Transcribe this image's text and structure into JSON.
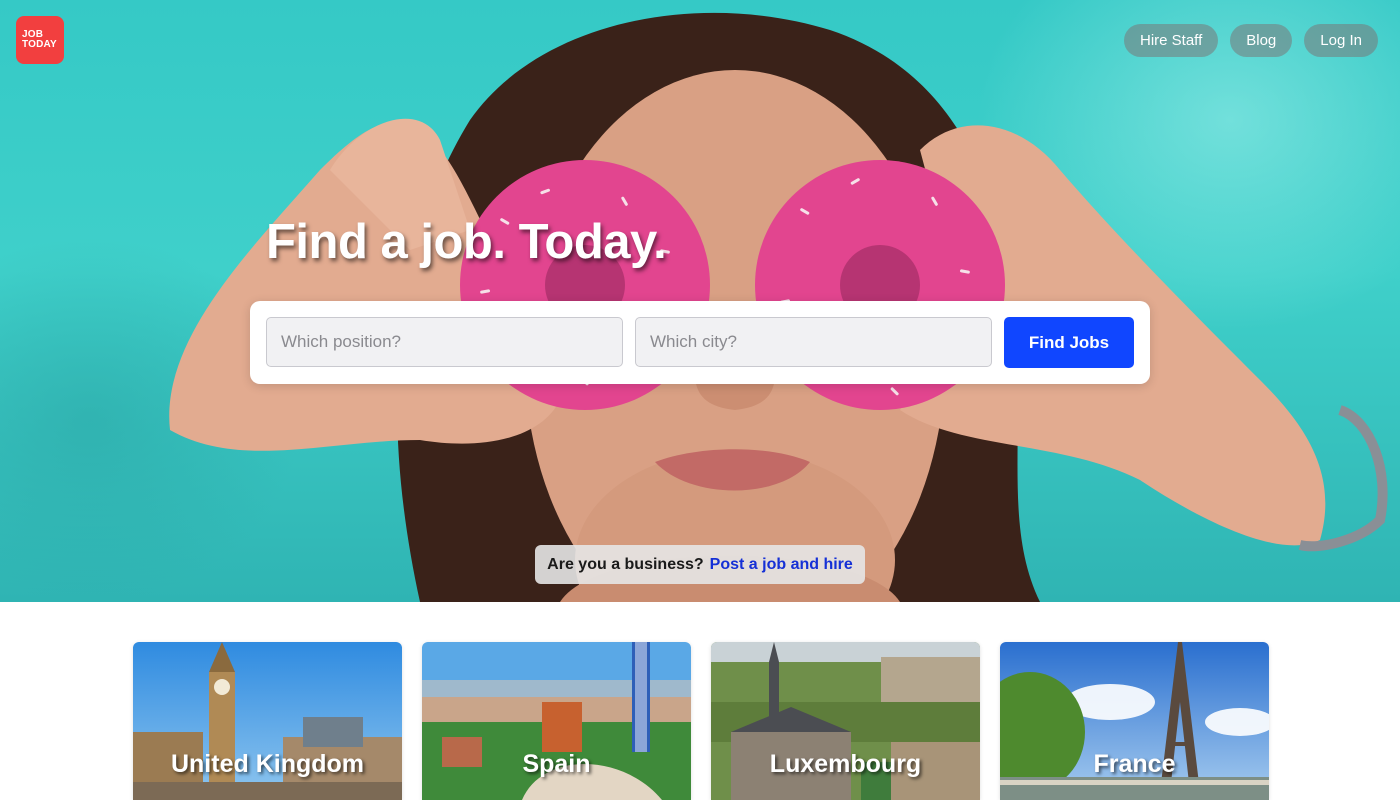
{
  "brand": {
    "logo_line1": "JOB",
    "logo_line2": "TODAY"
  },
  "nav": {
    "hire_staff": "Hire Staff",
    "blog": "Blog",
    "log_in": "Log In"
  },
  "hero": {
    "headline": "Find a job. Today."
  },
  "search": {
    "position_placeholder": "Which position?",
    "city_placeholder": "Which city?",
    "submit_label": "Find Jobs"
  },
  "business_banner": {
    "question": "Are you a business?",
    "link_text": "Post a job and hire"
  },
  "countries": [
    {
      "name": "United Kingdom"
    },
    {
      "name": "Spain"
    },
    {
      "name": "Luxembourg"
    },
    {
      "name": "France"
    }
  ],
  "colors": {
    "brand_red": "#f23f3f",
    "primary_blue": "#1046ff",
    "link_blue": "#1530d6",
    "hero_teal": "#3fd0ca"
  },
  "icons": {
    "hero_image": "woman-with-donuts-image"
  }
}
